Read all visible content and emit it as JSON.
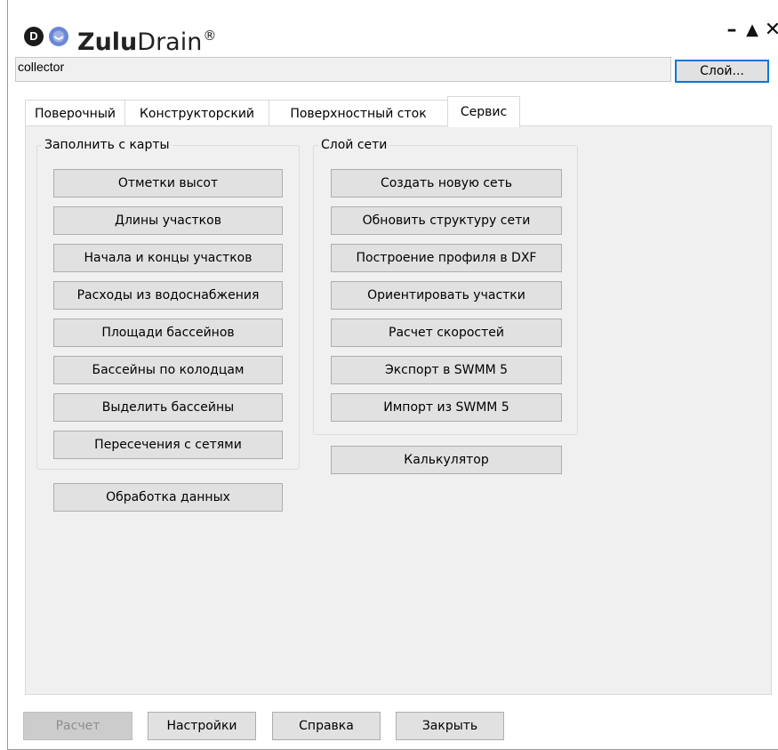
{
  "app": {
    "logo_letter": "D",
    "brand_part1": "Zulu",
    "brand_part2": "Drain",
    "brand_mark": "®",
    "minimize_symbol": "–",
    "maximize_symbol": "▲",
    "close_symbol": "✕"
  },
  "layer": {
    "value": "collector",
    "button_label": "Слой..."
  },
  "tabs": [
    {
      "label": "Поверочный"
    },
    {
      "label": "Конструкторский"
    },
    {
      "label": "Поверхностный сток"
    },
    {
      "label": "Сервис"
    }
  ],
  "active_tab": "Сервис",
  "fill_from_map": {
    "title": "Заполнить с карты",
    "buttons": [
      "Отметки высот",
      "Длины участков",
      "Начала и концы участков",
      "Расходы из водоснабжения",
      "Площади бассейнов",
      "Бассейны по колодцам",
      "Выделить бассейны",
      "Пересечения с сетями"
    ]
  },
  "network_layer": {
    "title": "Слой сети",
    "buttons": [
      "Создать новую сеть",
      "Обновить структуру сети",
      "Построение профиля в DXF",
      "Ориентировать участки",
      "Расчет скоростей",
      "Экспорт в SWMM 5",
      "Импорт из SWMM 5"
    ]
  },
  "data_processing_label": "Обработка данных",
  "calculator_label": "Калькулятор",
  "footer": {
    "calc_label": "Расчет",
    "settings_label": "Настройки",
    "help_label": "Справка",
    "close_label": "Закрыть"
  },
  "colors": {
    "panel_bg": "#f0f0f0",
    "button_bg": "#e1e1e1",
    "focus_border": "#0078d7",
    "logo_face": "#6a87d6"
  }
}
